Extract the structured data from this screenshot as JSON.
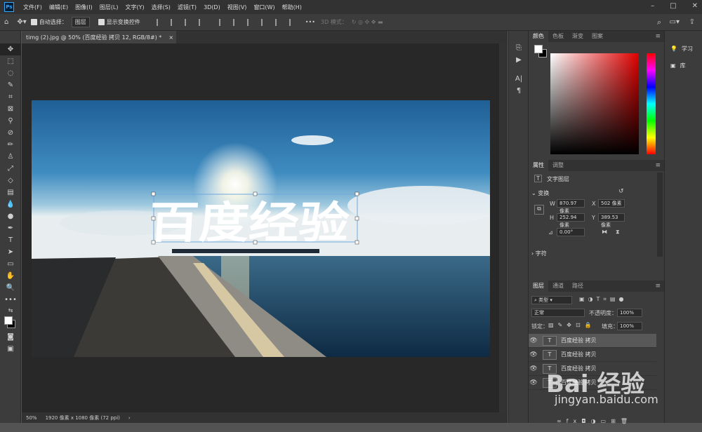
{
  "app": {
    "logo": "Ps"
  },
  "menu": [
    "文件(F)",
    "编辑(E)",
    "图像(I)",
    "图层(L)",
    "文字(Y)",
    "选择(S)",
    "滤镜(T)",
    "3D(D)",
    "视图(V)",
    "窗口(W)",
    "帮助(H)"
  ],
  "window_controls": [
    "–",
    "□",
    "✕"
  ],
  "options": {
    "auto_select_label": "自动选择：",
    "auto_select_value": "图层",
    "show_transform_label": "显示变换控件",
    "mode_3d": "3D 模式：",
    "more": "•••"
  },
  "document": {
    "tab_title": "timg (2).jpg @ 50% (百度经验 拷贝 12, RGB/8#) *",
    "close": "×",
    "canvas_text": "百度经验"
  },
  "status": {
    "zoom": "50%",
    "info": "1920 像素 x 1080 像素 (72 ppi)",
    "arrow": "›"
  },
  "color_panel": {
    "tabs": [
      "颜色",
      "色板",
      "渐变",
      "图案"
    ]
  },
  "properties": {
    "tabs": [
      "属性",
      "调整"
    ],
    "layer_type": "文字图层",
    "transform_label": "变换",
    "w_label": "W",
    "w_value": "870.97 像素",
    "x_label": "X",
    "x_value": "502 像素",
    "h_label": "H",
    "h_value": "252.94 像素",
    "y_label": "Y",
    "y_value": "389.53 像素",
    "angle": "0.00°",
    "char_label": "字符"
  },
  "layers": {
    "tabs": [
      "图层",
      "通道",
      "路径"
    ],
    "kind": "类型",
    "blend": "正常",
    "opacity_label": "不透明度：",
    "opacity": "100%",
    "lock_label": "锁定：",
    "fill_label": "填充：",
    "fill": "100%",
    "items": [
      {
        "name": "百度经验 拷贝"
      },
      {
        "name": "百度经验 拷贝"
      },
      {
        "name": "百度经验 拷贝"
      },
      {
        "name": "百度经验 拷贝"
      }
    ]
  },
  "side_panel": {
    "learn": "学习",
    "library": "库"
  },
  "watermark": {
    "brand": "Bai 经验",
    "url": "jingyan.baidu.com"
  },
  "colors": {
    "accent": "#31a8ff",
    "panel": "#3c3c3c",
    "bg": "#282828"
  }
}
